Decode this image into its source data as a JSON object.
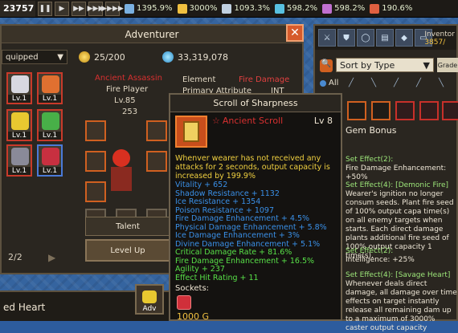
{
  "topbar": {
    "gold": "23757",
    "controls": [
      "❚❚",
      "▶",
      "▶▶",
      "▶▶▶",
      "▶▶▶▶"
    ],
    "stats": [
      {
        "icon": "sword-icon",
        "value": "1395.9%",
        "color": "#7ab0e0"
      },
      {
        "icon": "bolt-icon",
        "value": "3000%",
        "color": "#f0c040"
      },
      {
        "icon": "feather-icon",
        "value": "1093.3%",
        "color": "#c0d0e0"
      },
      {
        "icon": "arrow-icon",
        "value": "598.2%",
        "color": "#58c0e0"
      },
      {
        "icon": "shield-icon",
        "value": "598.2%",
        "color": "#c070d0"
      },
      {
        "icon": "fire-icon",
        "value": "190.6%",
        "color": "#e06040"
      }
    ]
  },
  "adventurer": {
    "title": "Adventurer",
    "equipped_label": "quipped",
    "party_count": "25/200",
    "gems": "33,319,078",
    "heroes": [
      {
        "lv": "Lv.1"
      },
      {
        "lv": "Lv.1"
      },
      {
        "lv": "Lv.1"
      },
      {
        "lv": "Lv.1"
      },
      {
        "lv": "Lv.1"
      },
      {
        "lv": "Lv.1"
      }
    ],
    "class_name": "Ancient Assassin",
    "player": "Fire Player",
    "level": "Lv.85",
    "attack": "253",
    "element_label": "Element",
    "element_value": "Fire Damage",
    "primary_label": "Primary Attribute",
    "primary_value": "INT",
    "talent_button": "Talent",
    "levelup_button": "Level Up",
    "pager": "2/2"
  },
  "inventory": {
    "label": "Inventor",
    "count": "3857/",
    "sort": "Sort by Type",
    "grade": "Grade",
    "all_label": "All"
  },
  "tooltip": {
    "title": "Scroll of Sharpness",
    "name": "Ancient Scroll",
    "level": "Lv 8",
    "description": "Whenver wearer has not received any attacks for 2 seconds, output capacity is increased by 199.9%",
    "stats": [
      {
        "text": "Vitality + 652",
        "c": ""
      },
      {
        "text": "Shadow Resistance + 1132",
        "c": ""
      },
      {
        "text": "Ice Resistance + 1354",
        "c": ""
      },
      {
        "text": "Poison Resistance + 1097",
        "c": ""
      },
      {
        "text": "Fire Damage Enhancement + 4.5%",
        "c": ""
      },
      {
        "text": "Physical Damage Enhancement + 5.8%",
        "c": ""
      },
      {
        "text": "Ice Damage Enhancement + 3%",
        "c": ""
      },
      {
        "text": "Divine Damage Enhancement + 5.1%",
        "c": ""
      },
      {
        "text": "Critical Damage Rate + 81.6%",
        "c": "g"
      },
      {
        "text": "Fire Damage Enhancement + 16.5%",
        "c": "g"
      },
      {
        "text": "Agility + 237",
        "c": "g"
      },
      {
        "text": "Effect Hit Rating + 11",
        "c": "g"
      }
    ],
    "sockets_label": "Sockets:",
    "price": "1000 G"
  },
  "gem_bonus": {
    "title": "Gem Bonus",
    "effects": [
      {
        "head": "Set Effect(2):",
        "body": "Fire Damage Enhancement: +50%"
      },
      {
        "head": "Set Effect(4): [Demonic Fire]",
        "body": "Wearer's ignition no longer consum seeds. Plant fire seed of 100% output capa time(s) on all enemy targets when starts. Each direct damage plants additional fire seed of 100% output capacity 1 time(s)."
      },
      {
        "head": "Set Effect(2):",
        "body": "Intelligence: +25%"
      },
      {
        "head": "Set Effect(4): [Savage Heart]",
        "body": "Whenever deals direct damage, all damage over time effects on target instantly release all remaining dam up to a maximum of 3000% caster output capacity"
      }
    ]
  },
  "bottom": {
    "left_text": "ed Heart",
    "adv_button": "Adv"
  }
}
